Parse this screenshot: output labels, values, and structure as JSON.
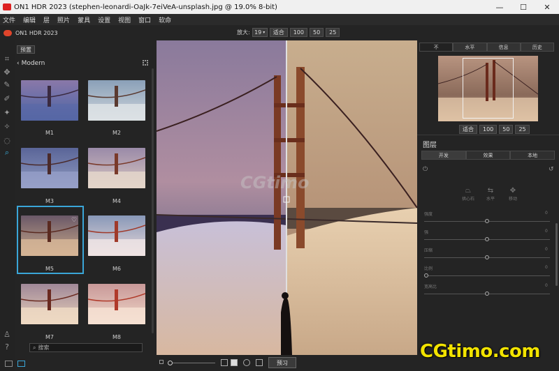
{
  "window": {
    "title": "ON1 HDR 2023 (stephen-leonardi-OaJk-7eiVeA-unsplash.jpg @ 19.0% 8-bit)",
    "minimize": "—",
    "maximize": "☐",
    "close": "✕"
  },
  "menu": [
    "文件",
    "编辑",
    "层",
    "照片",
    "蒙具",
    "设置",
    "视图",
    "窗口",
    "软命"
  ],
  "appbar": {
    "app_name": "ON1 HDR 2023",
    "zoom_label": "放大:",
    "zoom_value": "19",
    "zoom_buttons": [
      "适合",
      "100",
      "50",
      "25"
    ]
  },
  "presets": {
    "tab": "预置",
    "category": "Modern",
    "items": [
      {
        "label": "M1"
      },
      {
        "label": "M2"
      },
      {
        "label": "M3"
      },
      {
        "label": "M4"
      },
      {
        "label": "M5",
        "selected": true
      },
      {
        "label": "M6"
      },
      {
        "label": "M7"
      },
      {
        "label": "M8"
      }
    ],
    "search_placeholder": "搜索"
  },
  "canvas": {
    "watermark": "CGtimo",
    "preview_button": "预习"
  },
  "navigator": {
    "tabs": [
      "不",
      "水平",
      "信息",
      "历史"
    ],
    "zoom_buttons": [
      "适合",
      "100",
      "50",
      "25"
    ]
  },
  "layers": {
    "title": "图层",
    "tabs": [
      "开发",
      "效果",
      "本地"
    ],
    "modes": [
      "拱心石",
      "水平",
      "移动"
    ],
    "adjustments": [
      {
        "label": "强度",
        "value": "0",
        "level": 0.5
      },
      {
        "label": "强",
        "value": "0",
        "level": 0.5
      },
      {
        "label": "压缩",
        "value": "0",
        "level": 0.5
      },
      {
        "label": "比例",
        "value": "0",
        "level": 0.0
      },
      {
        "label": "宽高比",
        "value": "0",
        "level": 0.5
      }
    ]
  },
  "site_watermark": "CGtimo.com"
}
